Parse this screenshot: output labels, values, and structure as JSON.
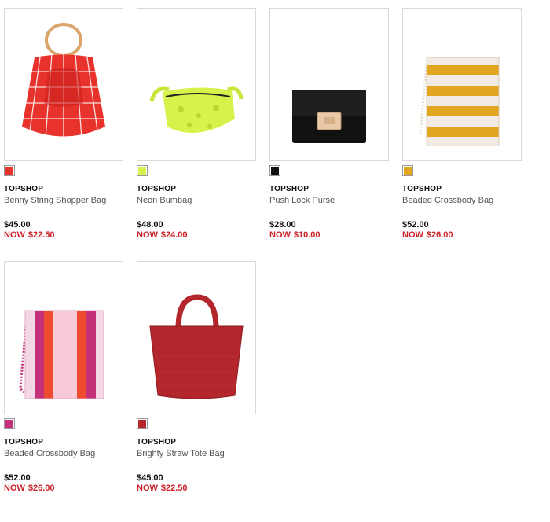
{
  "products": [
    {
      "brand": "TOPSHOP",
      "name": "Benny String Shopper Bag",
      "original_price": "$45.00",
      "sale_label": "NOW",
      "sale_price": "$22.50",
      "swatch_color": "#e8322c",
      "image": "red-string-shopper-bag"
    },
    {
      "brand": "TOPSHOP",
      "name": "Neon Bumbag",
      "original_price": "$48.00",
      "sale_label": "NOW",
      "sale_price": "$24.00",
      "swatch_color": "#d7f24a",
      "image": "neon-yellow-bumbag"
    },
    {
      "brand": "TOPSHOP",
      "name": "Push Lock Purse",
      "original_price": "$28.00",
      "sale_label": "NOW",
      "sale_price": "$10.00",
      "swatch_color": "#111111",
      "image": "black-push-lock-purse"
    },
    {
      "brand": "TOPSHOP",
      "name": "Beaded Crossbody Bag",
      "original_price": "$52.00",
      "sale_label": "NOW",
      "sale_price": "$26.00",
      "swatch_color": "#e0a61f",
      "image": "yellow-beaded-crossbody-bag"
    },
    {
      "brand": "TOPSHOP",
      "name": "Beaded Crossbody Bag",
      "original_price": "$52.00",
      "sale_label": "NOW",
      "sale_price": "$26.00",
      "swatch_color": "#c4307a",
      "image": "pink-beaded-crossbody-bag"
    },
    {
      "brand": "TOPSHOP",
      "name": "Brighty Straw Tote Bag",
      "original_price": "$45.00",
      "sale_label": "NOW",
      "sale_price": "$22.50",
      "swatch_color": "#b3262c",
      "image": "red-straw-tote-bag"
    }
  ]
}
